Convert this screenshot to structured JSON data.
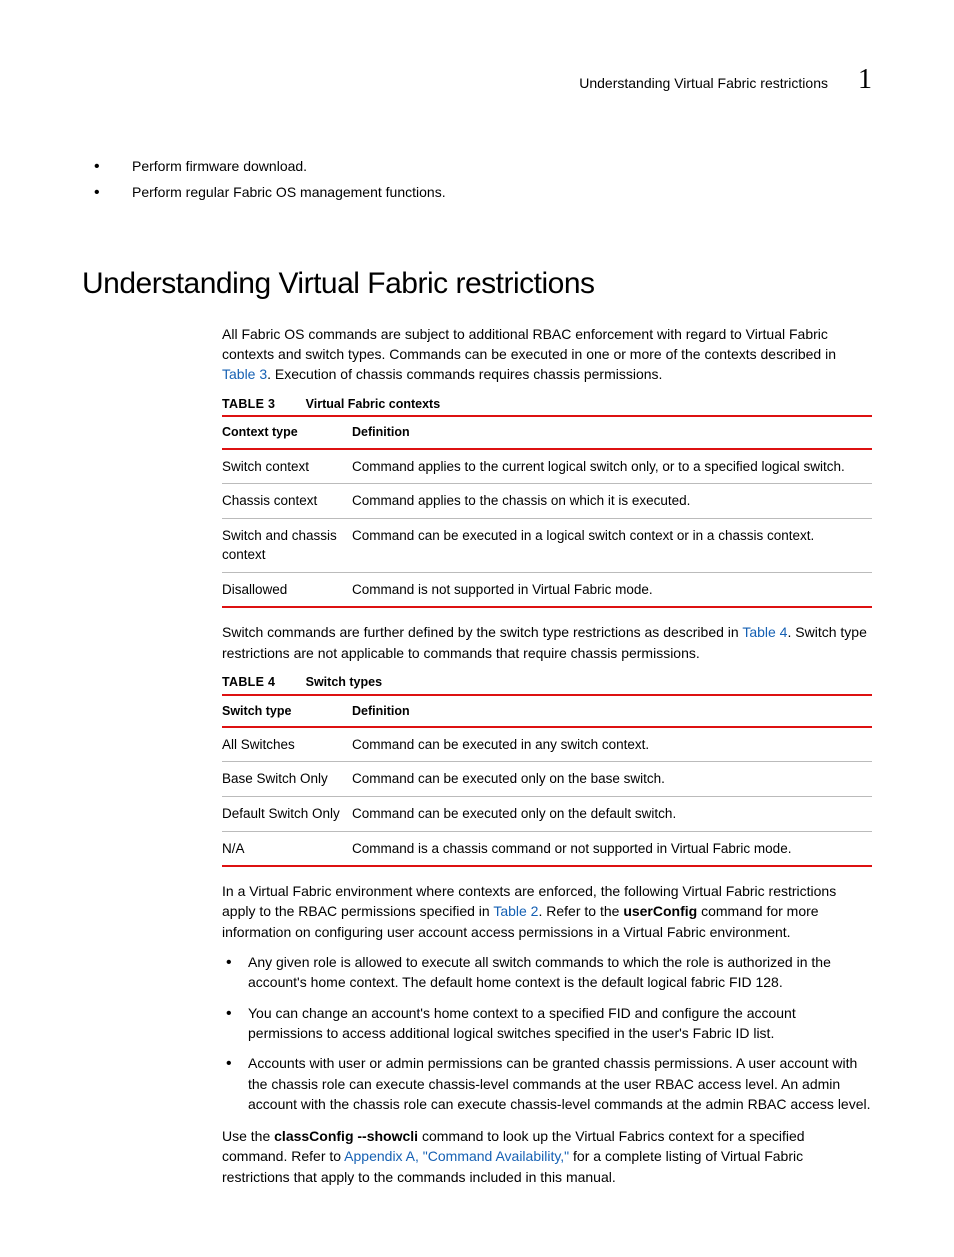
{
  "header": {
    "title": "Understanding Virtual Fabric restrictions",
    "chapter": "1"
  },
  "top_list": [
    "Perform firmware download.",
    "Perform regular Fabric OS management functions."
  ],
  "heading": "Understanding Virtual Fabric restrictions",
  "intro": {
    "p1a": "All Fabric OS commands are subject to additional RBAC enforcement with regard to Virtual Fabric contexts and switch types. Commands can be executed in one or more of the contexts described in ",
    "link1": "Table 3",
    "p1b": ".  Execution of chassis commands requires chassis permissions."
  },
  "table3": {
    "num": "TABLE 3",
    "title": "Virtual Fabric contexts",
    "headers": [
      "Context type",
      "Definition"
    ],
    "rows": [
      [
        "Switch context",
        "Command applies to the current logical switch only, or to a specified logical switch."
      ],
      [
        "Chassis context",
        "Command applies to the chassis on which it is executed."
      ],
      [
        "Switch and chassis context",
        "Command can be executed in a logical switch context or in a chassis context."
      ],
      [
        "Disallowed",
        "Command is not supported in Virtual Fabric mode."
      ]
    ]
  },
  "mid": {
    "p1a": "Switch commands are further defined by the switch type restrictions as described in ",
    "link1": "Table 4",
    "p1b": ". Switch type restrictions are not applicable to commands that require chassis permissions."
  },
  "table4": {
    "num": "TABLE 4",
    "title": "Switch types",
    "headers": [
      "Switch type",
      "Definition"
    ],
    "rows": [
      [
        "All Switches",
        "Command can be executed in any switch context."
      ],
      [
        "Base Switch Only",
        "Command can be executed only on the base switch."
      ],
      [
        "Default Switch Only",
        "Command can be executed only on the default switch."
      ],
      [
        "N/A",
        "Command is a chassis command or not supported in Virtual Fabric mode."
      ]
    ]
  },
  "after": {
    "p1a": "In a Virtual Fabric environment where contexts are enforced, the following Virtual Fabric restrictions apply to the RBAC permissions specified in ",
    "link1": "Table 2",
    "p1b": ". Refer to the ",
    "bold1": "userConfig",
    "p1c": " command for more information on configuring user account access permissions in a Virtual Fabric environment."
  },
  "restrictions": [
    "Any given role is allowed to execute all switch commands to which the role is authorized in the account's home context. The default home context is the default logical fabric FID 128.",
    "You can change an account's home context to a specified FID and configure the account permissions to access additional logical switches specified in the user's Fabric ID list.",
    "Accounts with user or admin permissions can be granted chassis permissions. A user account with the chassis role can execute chassis-level commands at the user RBAC access level. An admin account with the chassis role can execute chassis-level commands at the admin RBAC access level."
  ],
  "closing": {
    "p1a": "Use the ",
    "bold1": "classConfig --showcli",
    "p1b": " command to look up the Virtual Fabrics context for a specified command. Refer to ",
    "link1": "Appendix A, \"Command Availability,\"",
    "p1c": " for a complete listing of Virtual Fabric restrictions that apply to the commands included in this manual."
  }
}
